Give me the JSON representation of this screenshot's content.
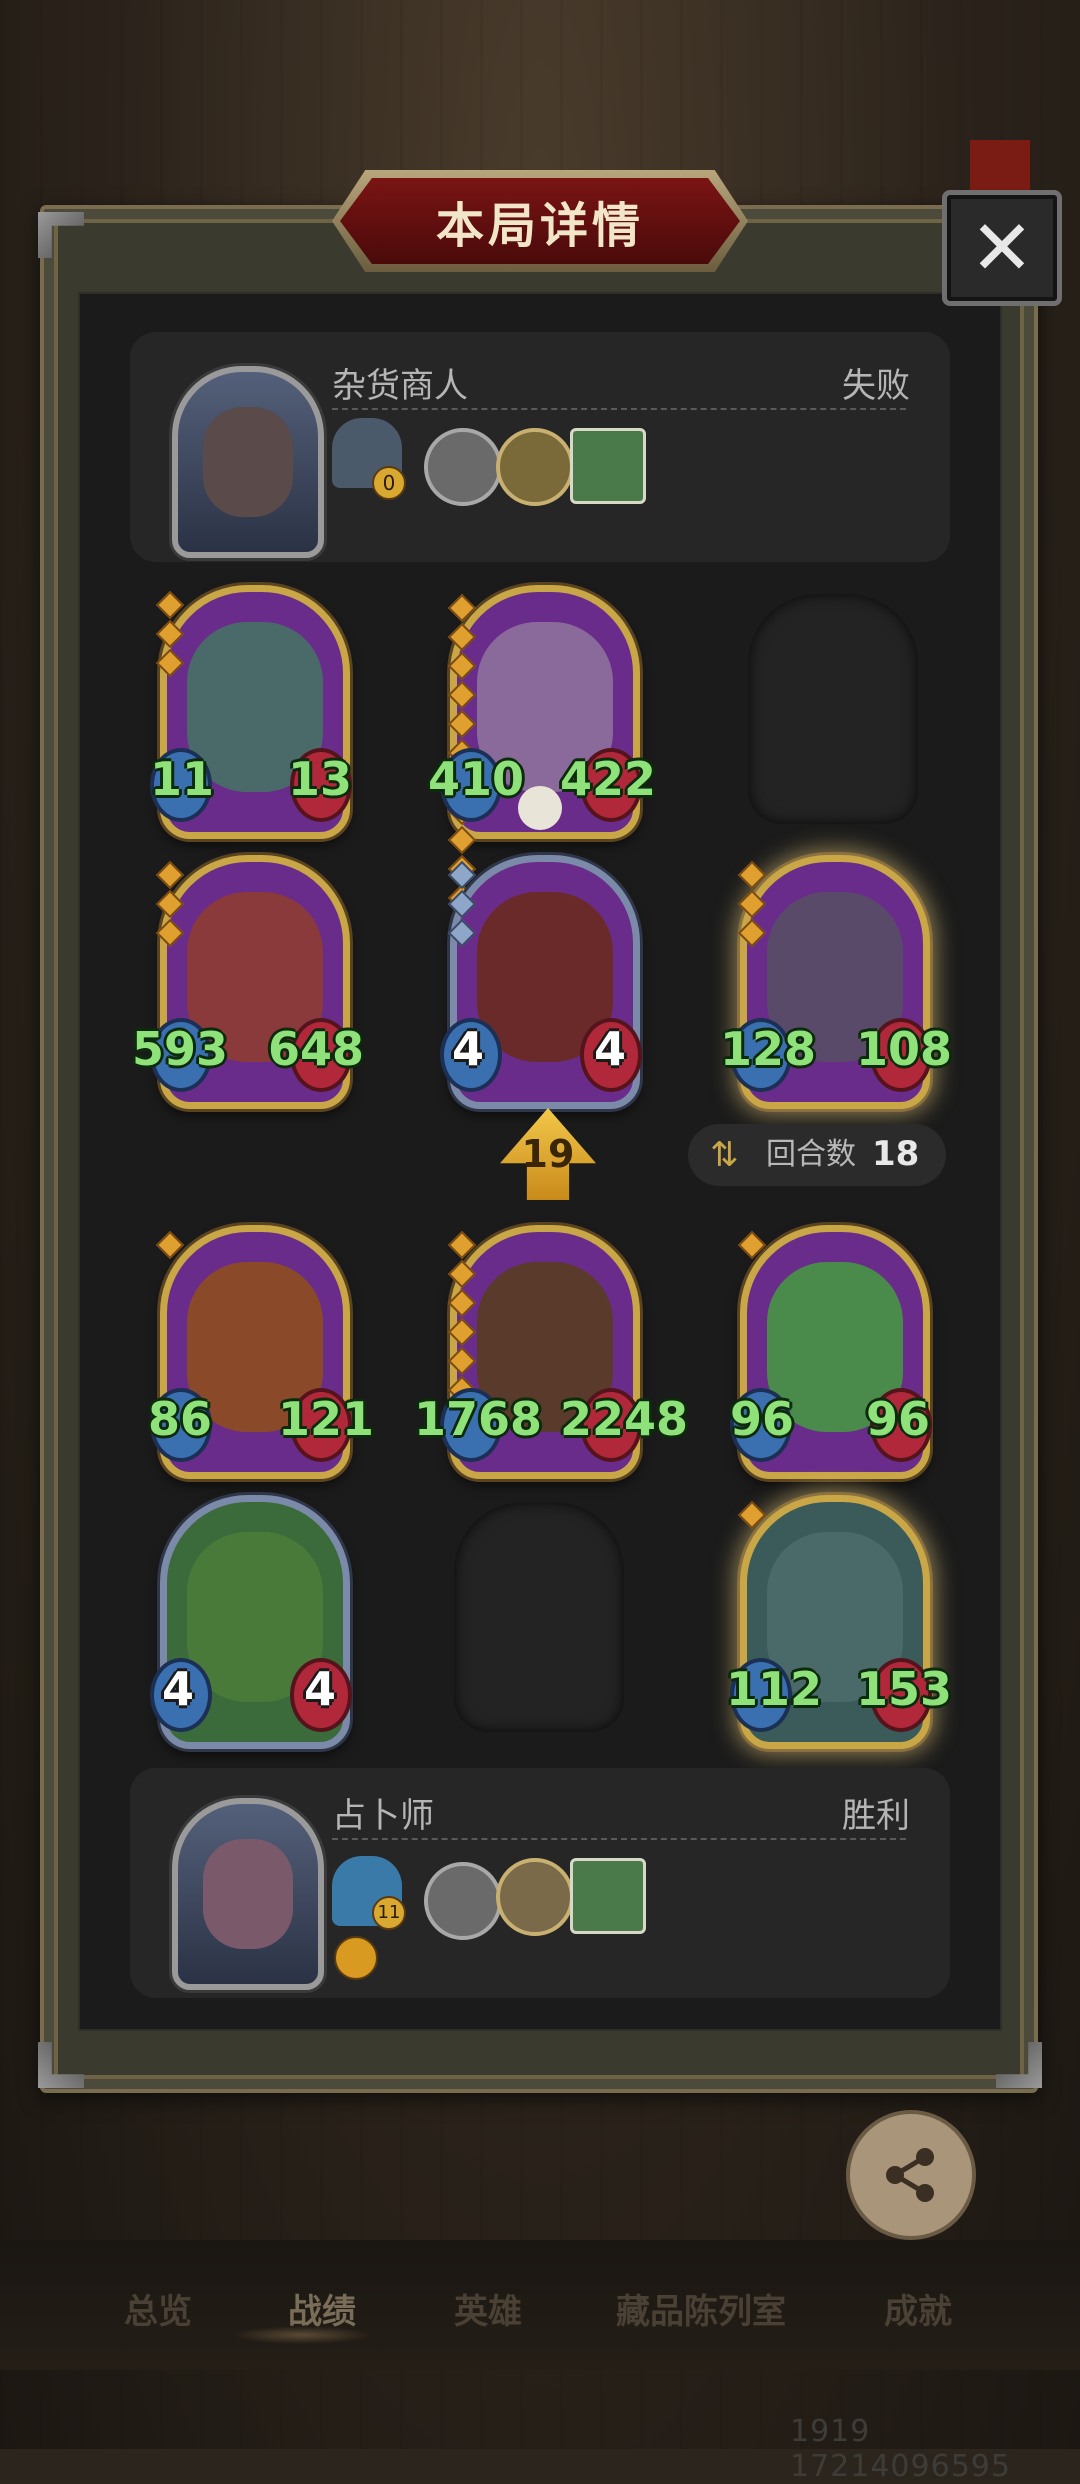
{
  "header": {
    "title": "本局详情",
    "close_label": "✕"
  },
  "opponent": {
    "name": "杂货商人",
    "result": "失败",
    "level_badge": "0",
    "equipment": [
      "statue-icon",
      "pocket-watch-icon",
      "coin-icon",
      "book-icon"
    ]
  },
  "player": {
    "name": "占卜师",
    "result": "胜利",
    "level_badge": "11",
    "equipment": [
      "card-icon",
      "pocket-watch-icon",
      "clock-medallion-icon",
      "book-icon",
      "gold-coin-icon"
    ]
  },
  "opponent_board": [
    {
      "atk": "11",
      "hp": "13",
      "frame": "gold",
      "art": "beast",
      "stars": 3
    },
    {
      "atk": "410",
      "hp": "422",
      "frame": "gold",
      "art": "old-man",
      "stars": 11
    },
    {
      "empty": true
    },
    {
      "atk": "593",
      "hp": "648",
      "frame": "gold",
      "art": "dragon",
      "stars": 3
    },
    {
      "atk": "4",
      "hp": "4",
      "frame": "silver",
      "art": "dragon",
      "stars": 3
    },
    {
      "atk": "128",
      "hp": "108",
      "frame": "gold-glow",
      "art": "skull-dragon",
      "stars": 3
    }
  ],
  "player_board": [
    {
      "atk": "86",
      "hp": "121",
      "frame": "gold",
      "art": "pumpkin",
      "stars": 1
    },
    {
      "atk": "1768",
      "hp": "2248",
      "frame": "gold",
      "art": "totem",
      "stars": 7
    },
    {
      "atk": "96",
      "hp": "96",
      "frame": "gold",
      "art": "cactus",
      "stars": 1
    },
    {
      "atk": "4",
      "hp": "4",
      "frame": "silver",
      "art": "cactus",
      "stars": 0
    },
    {
      "empty": true
    },
    {
      "atk": "112",
      "hp": "153",
      "frame": "gold-glow",
      "art": "beast",
      "stars": 1
    }
  ],
  "turn": {
    "current": "19",
    "round_label": "回合数",
    "round_value": "18"
  },
  "share": {
    "label": "分享"
  },
  "nav": {
    "items": [
      "总览",
      "战绩",
      "英雄",
      "藏品陈列室",
      "成就"
    ],
    "active": "战绩"
  },
  "uid": "1919 17214096595"
}
